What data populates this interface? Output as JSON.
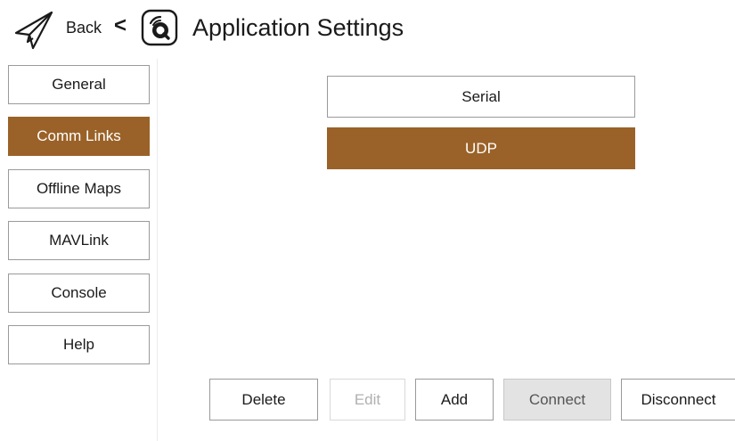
{
  "header": {
    "back_label": "Back",
    "back_chevron": "<",
    "title": "Application Settings",
    "plane_icon": "paper-plane-icon",
    "logo_icon": "qgc-logo-icon"
  },
  "sidebar": {
    "items": [
      {
        "label": "General",
        "selected": false
      },
      {
        "label": "Comm Links",
        "selected": true
      },
      {
        "label": "Offline Maps",
        "selected": false
      },
      {
        "label": "MAVLink",
        "selected": false
      },
      {
        "label": "Console",
        "selected": false
      },
      {
        "label": "Help",
        "selected": false
      }
    ]
  },
  "links": {
    "items": [
      {
        "label": "Serial",
        "selected": false
      },
      {
        "label": "UDP",
        "selected": true
      }
    ]
  },
  "buttons": {
    "delete": "Delete",
    "edit": "Edit",
    "add": "Add",
    "connect": "Connect",
    "disconnect": "Disconnect"
  },
  "colors": {
    "accent": "#9a6228",
    "border": "#9a9a9a",
    "pressed": "#e3e3e3",
    "disabled_text": "#b0b0b0"
  }
}
